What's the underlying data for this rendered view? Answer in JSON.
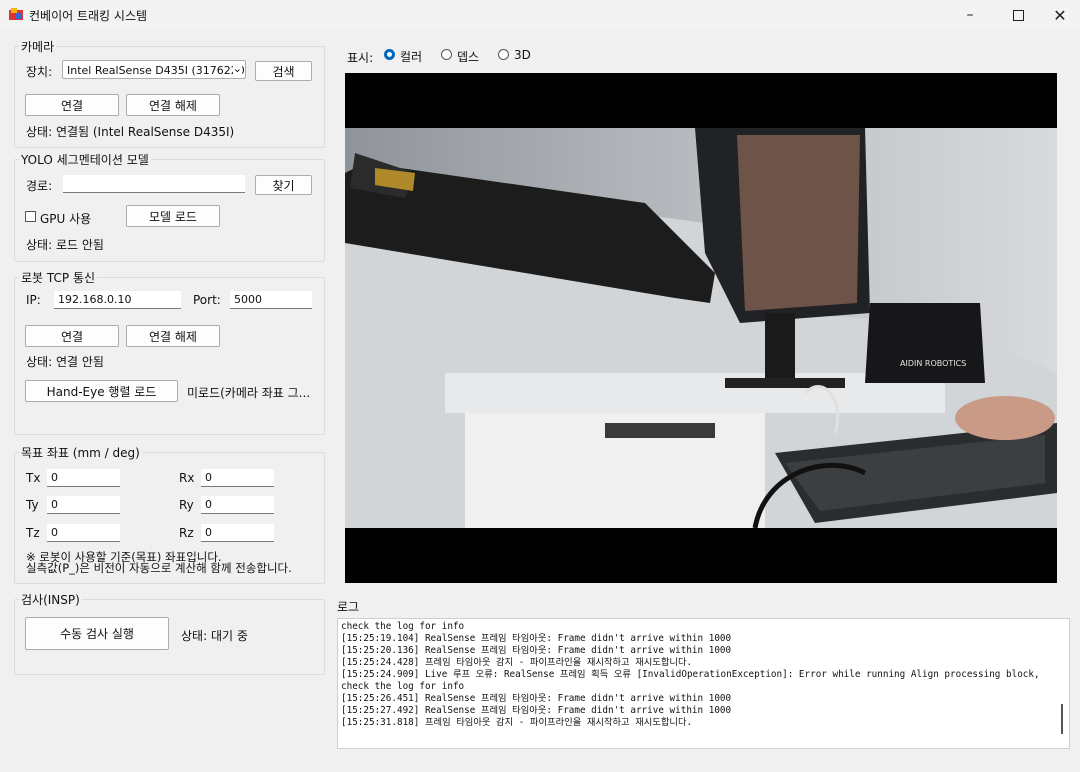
{
  "window": {
    "title": "컨베이어 트래킹 시스템",
    "min_icon": "minimize-icon",
    "max_icon": "maximize-icon",
    "close_icon": "close-icon"
  },
  "camera": {
    "title": "카메라",
    "device_label": "장치:",
    "device_value": "Intel RealSense D435I (31762207",
    "search_button": "검색",
    "connect_button": "연결",
    "disconnect_button": "연결 해제",
    "status": "상태: 연결됨 (Intel RealSense D435I)"
  },
  "yolo": {
    "title": "YOLO 세그멘테이션 모델",
    "path_label": "경로:",
    "path_value": "",
    "browse_button": "찾기",
    "gpu_label": "GPU 사용",
    "gpu_checked": false,
    "load_button": "모델 로드",
    "status": "상태: 로드 안됨"
  },
  "robot": {
    "title": "로봇 TCP 통신",
    "ip_label": "IP:",
    "ip_value": "192.168.0.10",
    "port_label": "Port:",
    "port_value": "5000",
    "connect_button": "연결",
    "disconnect_button": "연결 해제",
    "status": "상태: 연결 안됨",
    "handeye_button": "Hand-Eye 행렬 로드",
    "handeye_status": "미로드(카메라 좌표 그..."
  },
  "target": {
    "title": "목표 좌표 (mm / deg)",
    "tx_label": "Tx",
    "tx_value": "0",
    "ty_label": "Ty",
    "ty_value": "0",
    "tz_label": "Tz",
    "tz_value": "0",
    "rx_label": "Rx",
    "rx_value": "0",
    "ry_label": "Ry",
    "ry_value": "0",
    "rz_label": "Rz",
    "rz_value": "0",
    "note1": "※ 로봇이 사용할 기준(목표) 좌표입니다.",
    "note2": "실측값(P_)은 비전이 자동으로 계산해 함께 전송합니다."
  },
  "inspection": {
    "title": "검사(INSP)",
    "run_button": "수동 검사 실행",
    "status": "상태: 대기 중"
  },
  "display": {
    "label": "표시:",
    "options": [
      "컬러",
      "뎁스",
      "3D"
    ],
    "selected": "컬러"
  },
  "log": {
    "title": "로그",
    "lines": [
      "check the log for info",
      "[15:25:19.104] RealSense 프레임 타임아웃: Frame didn't arrive within 1000",
      "[15:25:20.136] RealSense 프레임 타임아웃: Frame didn't arrive within 1000",
      "[15:25:24.428] 프레임 타임아웃 감지 - 파이프라인을 재시작하고 재시도합니다.",
      "[15:25:24.909] Live 루프 오류: RealSense 프레임 획득 오류 [InvalidOperationException]: Error while running Align processing block,",
      "check the log for info",
      "[15:25:26.451] RealSense 프레임 타임아웃: Frame didn't arrive within 1000",
      "[15:25:27.492] RealSense 프레임 타임아웃: Frame didn't arrive within 1000",
      "[15:25:31.818] 프레임 타임아웃 감지 - 파이프라인을 재시작하고 재시도합니다."
    ]
  },
  "video": {
    "sign_text": "AIDIN ROBOTICS"
  }
}
